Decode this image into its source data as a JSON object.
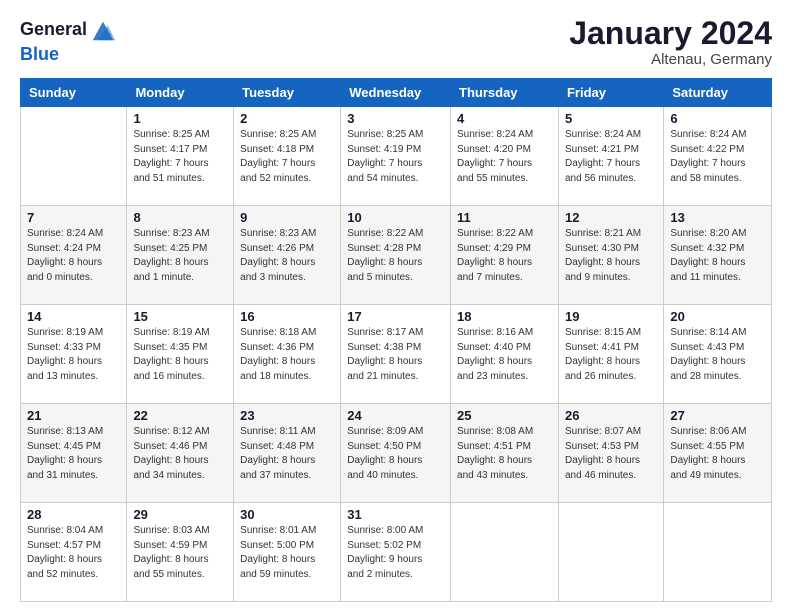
{
  "header": {
    "logo_line1": "General",
    "logo_line2": "Blue",
    "title": "January 2024",
    "subtitle": "Altenau, Germany"
  },
  "days": [
    "Sunday",
    "Monday",
    "Tuesday",
    "Wednesday",
    "Thursday",
    "Friday",
    "Saturday"
  ],
  "weeks": [
    [
      {
        "date": "",
        "sunrise": "",
        "sunset": "",
        "daylight": ""
      },
      {
        "date": "1",
        "sunrise": "Sunrise: 8:25 AM",
        "sunset": "Sunset: 4:17 PM",
        "daylight": "Daylight: 7 hours and 51 minutes."
      },
      {
        "date": "2",
        "sunrise": "Sunrise: 8:25 AM",
        "sunset": "Sunset: 4:18 PM",
        "daylight": "Daylight: 7 hours and 52 minutes."
      },
      {
        "date": "3",
        "sunrise": "Sunrise: 8:25 AM",
        "sunset": "Sunset: 4:19 PM",
        "daylight": "Daylight: 7 hours and 54 minutes."
      },
      {
        "date": "4",
        "sunrise": "Sunrise: 8:24 AM",
        "sunset": "Sunset: 4:20 PM",
        "daylight": "Daylight: 7 hours and 55 minutes."
      },
      {
        "date": "5",
        "sunrise": "Sunrise: 8:24 AM",
        "sunset": "Sunset: 4:21 PM",
        "daylight": "Daylight: 7 hours and 56 minutes."
      },
      {
        "date": "6",
        "sunrise": "Sunrise: 8:24 AM",
        "sunset": "Sunset: 4:22 PM",
        "daylight": "Daylight: 7 hours and 58 minutes."
      }
    ],
    [
      {
        "date": "7",
        "sunrise": "Sunrise: 8:24 AM",
        "sunset": "Sunset: 4:24 PM",
        "daylight": "Daylight: 8 hours and 0 minutes."
      },
      {
        "date": "8",
        "sunrise": "Sunrise: 8:23 AM",
        "sunset": "Sunset: 4:25 PM",
        "daylight": "Daylight: 8 hours and 1 minute."
      },
      {
        "date": "9",
        "sunrise": "Sunrise: 8:23 AM",
        "sunset": "Sunset: 4:26 PM",
        "daylight": "Daylight: 8 hours and 3 minutes."
      },
      {
        "date": "10",
        "sunrise": "Sunrise: 8:22 AM",
        "sunset": "Sunset: 4:28 PM",
        "daylight": "Daylight: 8 hours and 5 minutes."
      },
      {
        "date": "11",
        "sunrise": "Sunrise: 8:22 AM",
        "sunset": "Sunset: 4:29 PM",
        "daylight": "Daylight: 8 hours and 7 minutes."
      },
      {
        "date": "12",
        "sunrise": "Sunrise: 8:21 AM",
        "sunset": "Sunset: 4:30 PM",
        "daylight": "Daylight: 8 hours and 9 minutes."
      },
      {
        "date": "13",
        "sunrise": "Sunrise: 8:20 AM",
        "sunset": "Sunset: 4:32 PM",
        "daylight": "Daylight: 8 hours and 11 minutes."
      }
    ],
    [
      {
        "date": "14",
        "sunrise": "Sunrise: 8:19 AM",
        "sunset": "Sunset: 4:33 PM",
        "daylight": "Daylight: 8 hours and 13 minutes."
      },
      {
        "date": "15",
        "sunrise": "Sunrise: 8:19 AM",
        "sunset": "Sunset: 4:35 PM",
        "daylight": "Daylight: 8 hours and 16 minutes."
      },
      {
        "date": "16",
        "sunrise": "Sunrise: 8:18 AM",
        "sunset": "Sunset: 4:36 PM",
        "daylight": "Daylight: 8 hours and 18 minutes."
      },
      {
        "date": "17",
        "sunrise": "Sunrise: 8:17 AM",
        "sunset": "Sunset: 4:38 PM",
        "daylight": "Daylight: 8 hours and 21 minutes."
      },
      {
        "date": "18",
        "sunrise": "Sunrise: 8:16 AM",
        "sunset": "Sunset: 4:40 PM",
        "daylight": "Daylight: 8 hours and 23 minutes."
      },
      {
        "date": "19",
        "sunrise": "Sunrise: 8:15 AM",
        "sunset": "Sunset: 4:41 PM",
        "daylight": "Daylight: 8 hours and 26 minutes."
      },
      {
        "date": "20",
        "sunrise": "Sunrise: 8:14 AM",
        "sunset": "Sunset: 4:43 PM",
        "daylight": "Daylight: 8 hours and 28 minutes."
      }
    ],
    [
      {
        "date": "21",
        "sunrise": "Sunrise: 8:13 AM",
        "sunset": "Sunset: 4:45 PM",
        "daylight": "Daylight: 8 hours and 31 minutes."
      },
      {
        "date": "22",
        "sunrise": "Sunrise: 8:12 AM",
        "sunset": "Sunset: 4:46 PM",
        "daylight": "Daylight: 8 hours and 34 minutes."
      },
      {
        "date": "23",
        "sunrise": "Sunrise: 8:11 AM",
        "sunset": "Sunset: 4:48 PM",
        "daylight": "Daylight: 8 hours and 37 minutes."
      },
      {
        "date": "24",
        "sunrise": "Sunrise: 8:09 AM",
        "sunset": "Sunset: 4:50 PM",
        "daylight": "Daylight: 8 hours and 40 minutes."
      },
      {
        "date": "25",
        "sunrise": "Sunrise: 8:08 AM",
        "sunset": "Sunset: 4:51 PM",
        "daylight": "Daylight: 8 hours and 43 minutes."
      },
      {
        "date": "26",
        "sunrise": "Sunrise: 8:07 AM",
        "sunset": "Sunset: 4:53 PM",
        "daylight": "Daylight: 8 hours and 46 minutes."
      },
      {
        "date": "27",
        "sunrise": "Sunrise: 8:06 AM",
        "sunset": "Sunset: 4:55 PM",
        "daylight": "Daylight: 8 hours and 49 minutes."
      }
    ],
    [
      {
        "date": "28",
        "sunrise": "Sunrise: 8:04 AM",
        "sunset": "Sunset: 4:57 PM",
        "daylight": "Daylight: 8 hours and 52 minutes."
      },
      {
        "date": "29",
        "sunrise": "Sunrise: 8:03 AM",
        "sunset": "Sunset: 4:59 PM",
        "daylight": "Daylight: 8 hours and 55 minutes."
      },
      {
        "date": "30",
        "sunrise": "Sunrise: 8:01 AM",
        "sunset": "Sunset: 5:00 PM",
        "daylight": "Daylight: 8 hours and 59 minutes."
      },
      {
        "date": "31",
        "sunrise": "Sunrise: 8:00 AM",
        "sunset": "Sunset: 5:02 PM",
        "daylight": "Daylight: 9 hours and 2 minutes."
      },
      {
        "date": "",
        "sunrise": "",
        "sunset": "",
        "daylight": ""
      },
      {
        "date": "",
        "sunrise": "",
        "sunset": "",
        "daylight": ""
      },
      {
        "date": "",
        "sunrise": "",
        "sunset": "",
        "daylight": ""
      }
    ]
  ]
}
